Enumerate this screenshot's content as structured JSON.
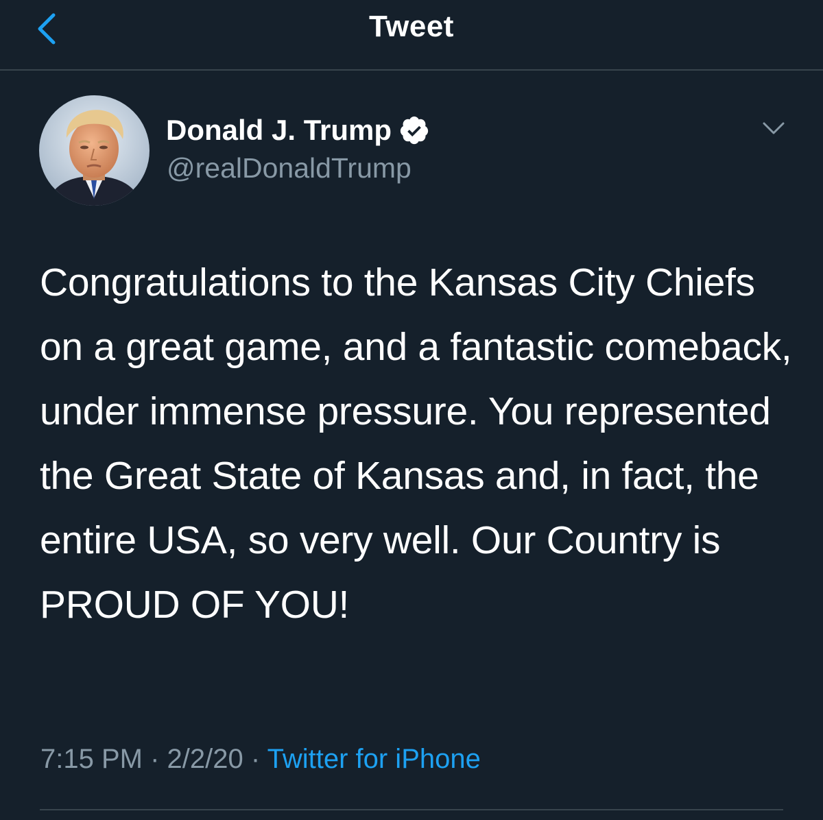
{
  "nav": {
    "title": "Tweet",
    "back_icon": "chevron-left-icon"
  },
  "author": {
    "display_name": "Donald J. Trump",
    "handle": "@realDonaldTrump",
    "verified": true,
    "verified_icon": "verified-badge-icon",
    "more_icon": "chevron-down-icon"
  },
  "tweet": {
    "text": "Congratulations to the Kansas City Chiefs on a great game, and a fantastic comeback, under immense pressure. You represented the Great State of Kansas and, in fact, the entire USA, so very well. Our Country is PROUD OF YOU!",
    "time": "7:15 PM",
    "separator": "·",
    "date": "2/2/20",
    "source": "Twitter for iPhone"
  },
  "colors": {
    "background": "#15202b",
    "accent": "#1da1f2",
    "secondary_text": "#8899a6",
    "divider": "#38444d"
  }
}
